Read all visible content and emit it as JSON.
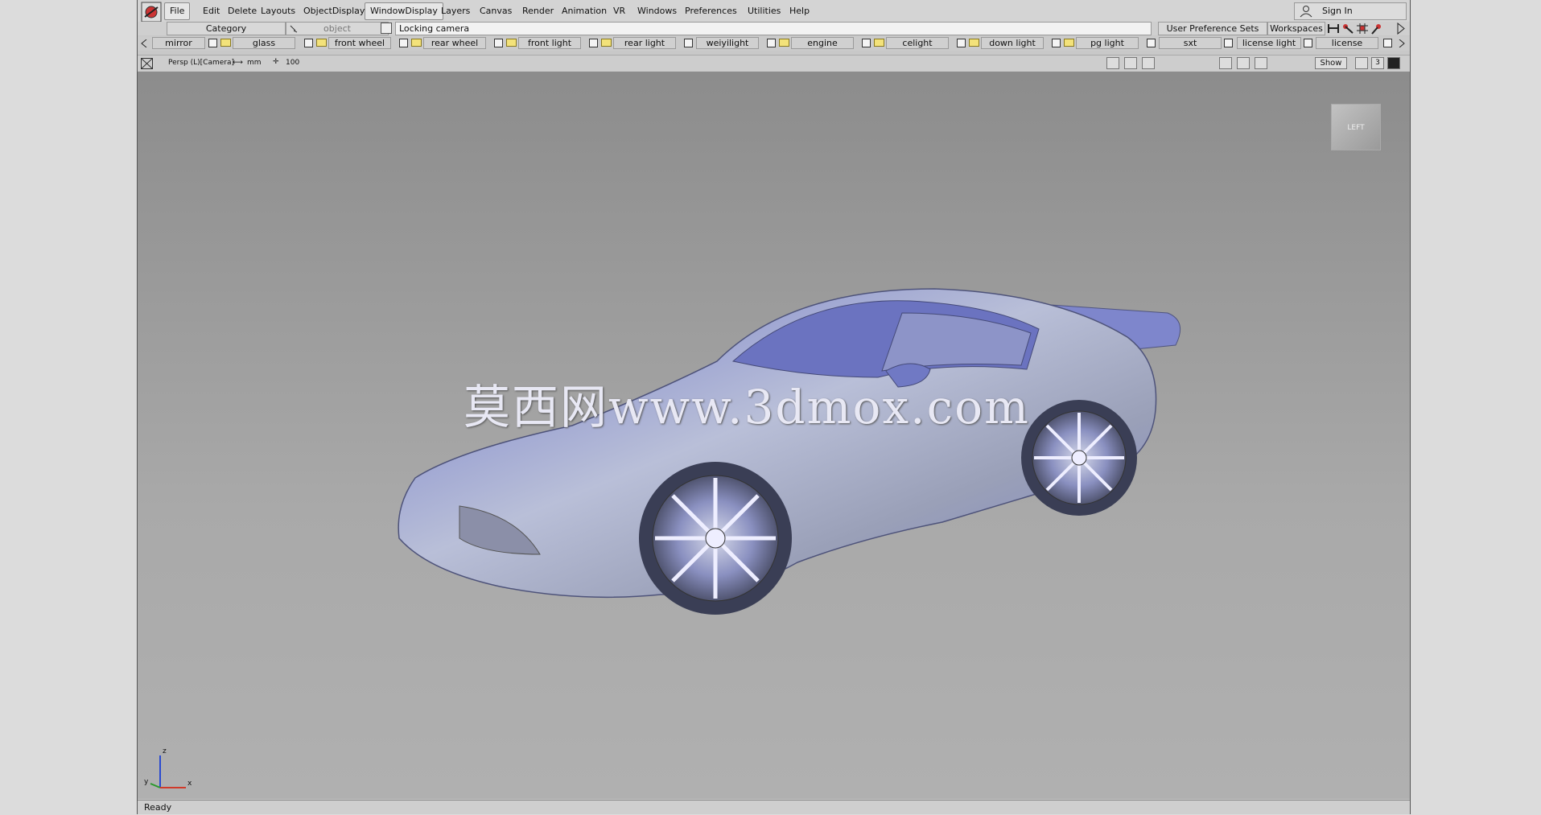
{
  "app": {
    "logo_caption": "screen"
  },
  "menu": [
    "File",
    "Edit",
    "Delete",
    "Layouts",
    "ObjectDisplay",
    "WindowDisplay",
    "Layers",
    "Canvas",
    "Render",
    "Animation",
    "VR",
    "Windows",
    "Preferences",
    "Utilities",
    "Help"
  ],
  "signin": {
    "label": "Sign In"
  },
  "toolbar": {
    "category": "Category",
    "object_placeholder": "object",
    "locking_field": "Locking camera",
    "user_pref_sets": "User Preference Sets",
    "workspaces": "Workspaces"
  },
  "layers": [
    "mirror",
    "glass",
    "front wheel",
    "rear wheel",
    "front light",
    "rear light",
    "weiyilight",
    "engine",
    "celight",
    "down light",
    "pg light",
    "sxt",
    "license light",
    "license"
  ],
  "viewport_header": {
    "camera": "Persp (L)[Camera]",
    "units": "mm",
    "scale": "100",
    "show_label": "Show",
    "layout_num": "3"
  },
  "viewport": {
    "watermark": "莫西网www.3dmox.com",
    "viewcube_label": "LEFT",
    "axis_z": "z",
    "axis_y": "y",
    "axis_x": "x"
  },
  "status": {
    "text": "Ready"
  }
}
